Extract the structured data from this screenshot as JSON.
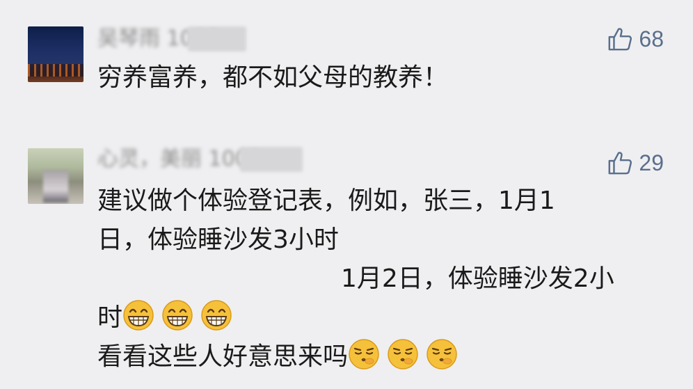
{
  "comments": [
    {
      "username": "吴琴雨 1000",
      "likes": "68",
      "lines": [
        "穷养富养，都不如父母的教养！"
      ]
    },
    {
      "username": "心灵，美丽 1000",
      "likes": "29",
      "lines": [
        "建议做个体验登记表，例如，张三，1月1",
        "日，体验睡沙发3小时",
        "1月2日，体验睡沙发2小",
        "时",
        "看看这些人好意思来吗"
      ],
      "emojis": {
        "grin_count": 3,
        "smirk_count": 3
      }
    }
  ],
  "icons": {
    "like": "thumbs-up-icon",
    "grin": "grinning-face-icon",
    "smirk": "smirking-face-icon"
  },
  "colors": {
    "background": "#efeff1",
    "accent": "#5a6f8c",
    "emoji": "#f6c13a"
  }
}
